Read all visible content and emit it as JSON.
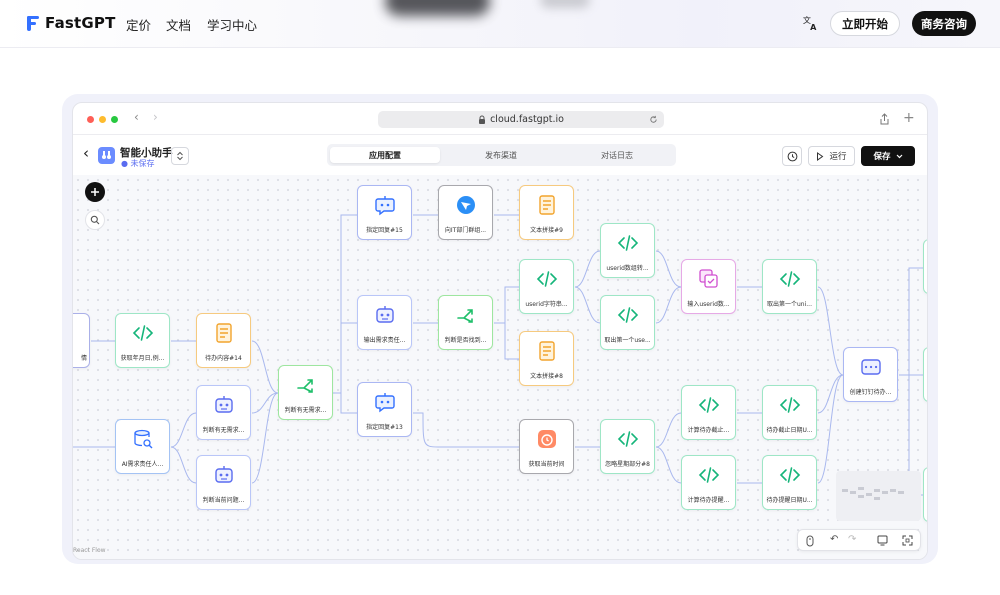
{
  "site": {
    "brand": "FastGPT",
    "nav": [
      "定价",
      "文档",
      "学习中心"
    ],
    "cta_start": "立即开始",
    "cta_contact": "商务咨询"
  },
  "browser": {
    "url": "cloud.fastgpt.io"
  },
  "app": {
    "title": "智能小助手",
    "status": "● 未保存",
    "tabs": [
      {
        "label": "应用配置",
        "active": true
      },
      {
        "label": "发布渠道",
        "active": false
      },
      {
        "label": "对话日志",
        "active": false
      }
    ],
    "run_label": "运行",
    "save_label": "保存"
  },
  "canvas": {
    "watermark": "React Flow",
    "nodes": [
      {
        "id": "n-ai",
        "label": "AI需求责任人...",
        "kind": "ai"
      },
      {
        "id": "n-cut",
        "label": "情",
        "kind": "cut"
      },
      {
        "id": "n-code1",
        "label": "获取年月日,例...",
        "kind": "code"
      },
      {
        "id": "n-text1",
        "label": "待办内容#14",
        "kind": "text"
      },
      {
        "id": "n-bot1",
        "label": "判断有无需求...",
        "kind": "bot"
      },
      {
        "id": "n-bot2",
        "label": "判断当前问题...",
        "kind": "bot"
      },
      {
        "id": "n-branch1",
        "label": "判断有无需求...",
        "kind": "branch"
      },
      {
        "id": "n-reply15",
        "label": "指定回复#15",
        "kind": "reply"
      },
      {
        "id": "n-bot3",
        "label": "输出需求责任...",
        "kind": "bot"
      },
      {
        "id": "n-reply13",
        "label": "指定回复#13",
        "kind": "reply"
      },
      {
        "id": "n-feishu",
        "label": "向IT部门群组...",
        "kind": "feishu"
      },
      {
        "id": "n-branch2",
        "label": "判断是否找到...",
        "kind": "branch"
      },
      {
        "id": "n-time",
        "label": "获取当前时间",
        "kind": "time"
      },
      {
        "id": "n-text9",
        "label": "文本拼接#9",
        "kind": "text"
      },
      {
        "id": "n-code2",
        "label": "userid字符串...",
        "kind": "code"
      },
      {
        "id": "n-text8",
        "label": "文本拼接#8",
        "kind": "text"
      },
      {
        "id": "n-code3",
        "label": "userid数组转...",
        "kind": "code"
      },
      {
        "id": "n-code4",
        "label": "取出第一个use...",
        "kind": "code"
      },
      {
        "id": "n-code5",
        "label": "忽略星期部分#8",
        "kind": "code"
      },
      {
        "id": "n-input",
        "label": "输入userid数...",
        "kind": "input"
      },
      {
        "id": "n-code6",
        "label": "计算待办截止...",
        "kind": "code"
      },
      {
        "id": "n-code7",
        "label": "计算待办提醒...",
        "kind": "code"
      },
      {
        "id": "n-code8",
        "label": "取出第一个uni...",
        "kind": "code"
      },
      {
        "id": "n-code9",
        "label": "待办截止日期U...",
        "kind": "code"
      },
      {
        "id": "n-code10",
        "label": "待办提醒日期U...",
        "kind": "code"
      },
      {
        "id": "n-dingtalk",
        "label": "创建钉钉待办...",
        "kind": "dingtalk"
      }
    ]
  }
}
